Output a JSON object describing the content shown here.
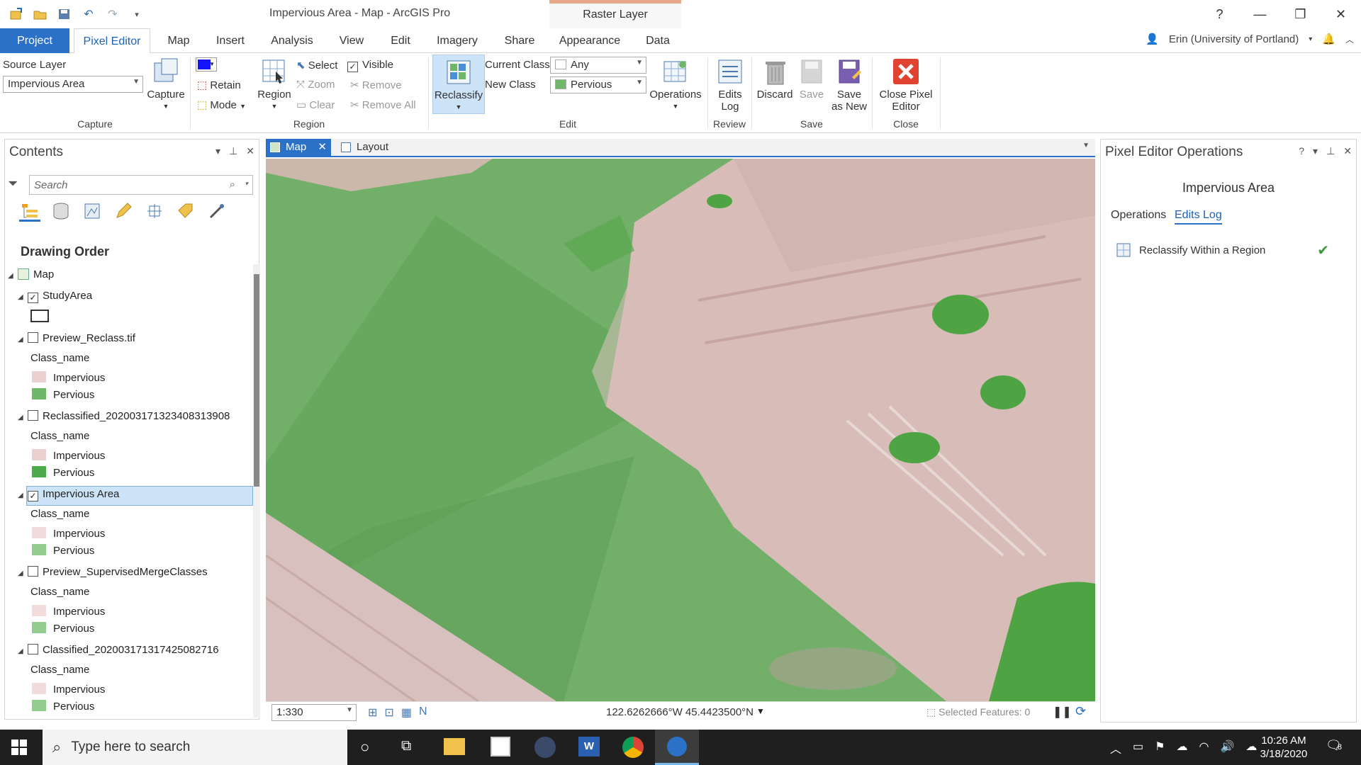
{
  "window": {
    "title": "Impervious Area - Map - ArcGIS Pro",
    "context_tab": "Raster Layer",
    "help": "?"
  },
  "ribbon_tabs": [
    "Project",
    "Pixel Editor",
    "Map",
    "Insert",
    "Analysis",
    "View",
    "Edit",
    "Imagery",
    "Share",
    "Appearance",
    "Data"
  ],
  "user": {
    "name": "Erin (University of Portland)"
  },
  "capture": {
    "source_layer_label": "Source Layer",
    "source_layer_value": "Impervious Area",
    "capture_label": "Capture",
    "group": "Capture"
  },
  "region": {
    "retain": "Retain",
    "mode": "Mode",
    "region_btn": "Region",
    "select": "Select",
    "visible": "Visible",
    "zoom": "Zoom",
    "remove": "Remove",
    "clear": "Clear",
    "remove_all": "Remove All",
    "group": "Region"
  },
  "edit": {
    "reclassify": "Reclassify",
    "current_class_label": "Current Class",
    "current_class_value": "Any",
    "new_class_label": "New Class",
    "new_class_value": "Pervious",
    "operations": "Operations",
    "group": "Edit"
  },
  "review": {
    "edits_log_1": "Edits",
    "edits_log_2": "Log",
    "group": "Review"
  },
  "save": {
    "discard": "Discard",
    "save": "Save",
    "save_new_1": "Save",
    "save_new_2": "as New",
    "group": "Save"
  },
  "close": {
    "close_1": "Close Pixel",
    "close_2": "Editor",
    "group": "Close"
  },
  "contents": {
    "title": "Contents",
    "search_placeholder": "Search",
    "drawing_order": "Drawing Order",
    "map": "Map",
    "layers": [
      {
        "name": "StudyArea",
        "checked": true
      },
      {
        "name": "Preview_Reclass.tif",
        "checked": false,
        "field": "Class_name",
        "classes": [
          "Impervious",
          "Pervious"
        ]
      },
      {
        "name": "Reclassified_20200317132340831390​8",
        "checked": false,
        "field": "Class_name",
        "classes": [
          "Impervious",
          "Pervious"
        ]
      },
      {
        "name": "Impervious Area",
        "checked": true,
        "field": "Class_name",
        "classes": [
          "Impervious",
          "Pervious"
        ]
      },
      {
        "name": "Preview_SupervisedMergeClasses",
        "checked": false,
        "field": "Class_name",
        "classes": [
          "Impervious",
          "Pervious"
        ]
      },
      {
        "name": "Classified_20200317131742508271​6",
        "checked": false,
        "field": "Class_name",
        "classes": [
          "Impervious",
          "Pervious"
        ]
      }
    ]
  },
  "doc_tabs": [
    "Map",
    "Layout"
  ],
  "status": {
    "scale": "1:330",
    "coords": "122.6262666°W 45.4423500°N",
    "selected": "Selected Features: 0"
  },
  "right_pane": {
    "title": "Pixel Editor Operations",
    "layer": "Impervious Area",
    "tabs": [
      "Operations",
      "Edits Log"
    ],
    "log_item": "Reclassify Within a Region"
  },
  "taskbar": {
    "search": "Type here to search",
    "time": "10:26 AM",
    "date": "3/18/2020",
    "notif": "8"
  },
  "colors": {
    "accent": "#2b71c8",
    "impervious": "#e3c7c5",
    "pervious": "#6fb86a",
    "selection": "#cde3f7"
  }
}
